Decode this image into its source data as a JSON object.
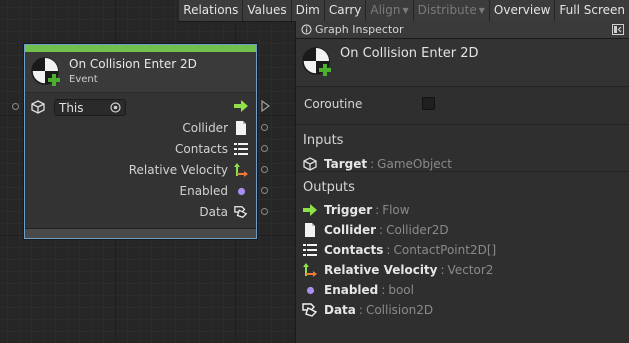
{
  "toolbar": {
    "buttons": [
      {
        "label": "Relations",
        "enabled": true
      },
      {
        "label": "Values",
        "enabled": true
      },
      {
        "label": "Dim",
        "enabled": true
      },
      {
        "label": "Carry",
        "enabled": true
      },
      {
        "label": "Align",
        "enabled": false,
        "dropdown": true
      },
      {
        "label": "Distribute",
        "enabled": false,
        "dropdown": true
      },
      {
        "label": "Overview",
        "enabled": true
      },
      {
        "label": "Full Screen",
        "enabled": true
      }
    ]
  },
  "node": {
    "title": "On Collision Enter 2D",
    "subtitle": "Event",
    "target_value": "This",
    "ports": [
      {
        "label": "",
        "icon": "flow-arrow-icon"
      },
      {
        "label": "Collider",
        "icon": "document-icon"
      },
      {
        "label": "Contacts",
        "icon": "list-icon"
      },
      {
        "label": "Relative Velocity",
        "icon": "vector-icon"
      },
      {
        "label": "Enabled",
        "icon": "bool-dot-icon"
      },
      {
        "label": "Data",
        "icon": "data-hand-icon"
      }
    ]
  },
  "inspector": {
    "tab_label": "Graph Inspector",
    "title": "On Collision Enter 2D",
    "coroutine_label": "Coroutine",
    "coroutine_checked": false,
    "inputs_title": "Inputs",
    "inputs": [
      {
        "name": "Target",
        "type": "GameObject",
        "icon": "cube-icon"
      }
    ],
    "outputs_title": "Outputs",
    "outputs": [
      {
        "name": "Trigger",
        "type": "Flow",
        "icon": "flow-arrow-icon"
      },
      {
        "name": "Collider",
        "type": "Collider2D",
        "icon": "document-icon"
      },
      {
        "name": "Contacts",
        "type": "ContactPoint2D[]",
        "icon": "list-icon"
      },
      {
        "name": "Relative Velocity",
        "type": "Vector2",
        "icon": "vector-icon"
      },
      {
        "name": "Enabled",
        "type": "bool",
        "icon": "bool-dot-icon"
      },
      {
        "name": "Data",
        "type": "Collision2D",
        "icon": "data-hand-icon"
      }
    ],
    "type_separator": ":"
  },
  "colors": {
    "accent_green": "#72c04e",
    "node_border": "#6f9fc9",
    "bool_purple": "#a88ef0",
    "vector_orange": "#f07a3a"
  }
}
